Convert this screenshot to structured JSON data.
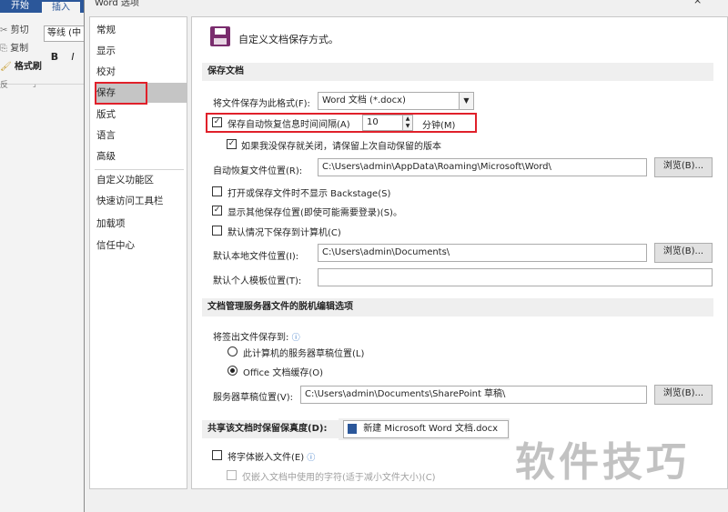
{
  "ribbon": {
    "tab_home": "开始",
    "tab_insert": "插入",
    "cut": "剪切",
    "copy": "复制",
    "format_painter": "格式刷",
    "font_name": "等线 (中",
    "bold": "B",
    "italic": "I",
    "group_label": "反"
  },
  "dialog": {
    "title": "Word 选项",
    "close": "×"
  },
  "nav": {
    "items": [
      "常规",
      "显示",
      "校对",
      "保存",
      "版式",
      "语言",
      "高级",
      "自定义功能区",
      "快速访问工具栏",
      "加载项",
      "信任中心"
    ],
    "selected": "保存"
  },
  "header": {
    "title": "自定义文档保存方式。"
  },
  "save_docs": {
    "section_title": "保存文档",
    "format_label": "将文件保存为此格式(F):",
    "format_value": "Word 文档 (*.docx)",
    "autorecover_label": "保存自动恢复信息时间间隔(A)",
    "autorecover_checked": true,
    "autorecover_minutes": "10",
    "minutes_label": "分钟(M)",
    "keep_last_label": "如果我没保存就关闭，请保留上次自动保留的版本",
    "keep_last_checked": true,
    "autorecover_location_label": "自动恢复文件位置(R):",
    "autorecover_location_value": "C:\\Users\\admin\\AppData\\Roaming\\Microsoft\\Word\\",
    "browse1": "浏览(B)...",
    "no_backstage_label": "打开或保存文件时不显示 Backstage(S)",
    "no_backstage_checked": false,
    "show_more_label": "显示其他保存位置(即使可能需要登录)(S)。",
    "show_more_checked": true,
    "save_to_computer_label": "默认情况下保存到计算机(C)",
    "save_to_computer_checked": false,
    "local_location_label": "默认本地文件位置(I):",
    "local_location_value": "C:\\Users\\admin\\Documents\\",
    "browse2": "浏览(B)...",
    "template_location_label": "默认个人模板位置(T):",
    "template_location_value": ""
  },
  "offline": {
    "section_title": "文档管理服务器文件的脱机编辑选项",
    "save_checkedout_label": "将签出文件保存到:",
    "info_icon": "ⓘ",
    "option_server_label": "此计算机的服务器草稿位置(L)",
    "option_cache_label": "Office 文档缓存(O)",
    "selected_option": "Office 文档缓存(O)",
    "drafts_location_label": "服务器草稿位置(V):",
    "drafts_location_value": "C:\\Users\\admin\\Documents\\SharePoint 草稿\\",
    "browse3": "浏览(B)..."
  },
  "fidelity": {
    "section_title": "共享该文档时保留保真度(D):",
    "document_value": "新建 Microsoft Word 文档.docx",
    "embed_fonts_label": "将字体嵌入文件(E)",
    "embed_fonts_checked": false,
    "embed_used_only_label": "仅嵌入文档中使用的字符(适于减小文件大小)(C)"
  },
  "watermark": "软件技巧",
  "colors": {
    "highlight_red": "#e0202a",
    "ribbon_blue": "#2b579a",
    "save_icon_purple": "#7a2d6e"
  }
}
